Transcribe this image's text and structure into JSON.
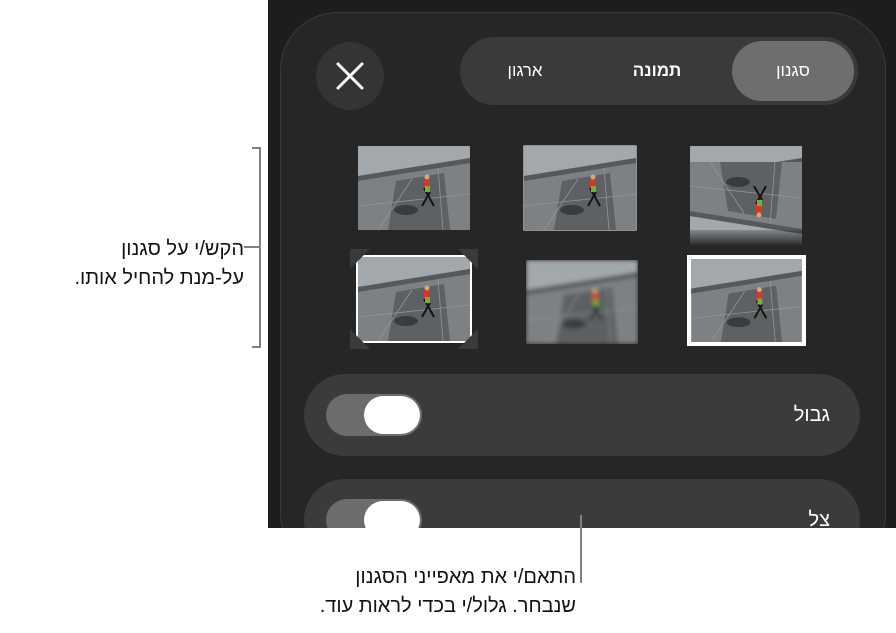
{
  "tabs": [
    {
      "label": "סגנון",
      "selected": true
    },
    {
      "label": "תמונה",
      "selected": false
    },
    {
      "label": "ארגון",
      "selected": false
    }
  ],
  "close_button": {
    "icon": "close-icon"
  },
  "styles": [
    {
      "name": "plain",
      "selected": false
    },
    {
      "name": "thin-white-border",
      "selected": false
    },
    {
      "name": "reflection",
      "selected": false
    },
    {
      "name": "photo-corners",
      "selected": false
    },
    {
      "name": "soft-edges",
      "selected": false
    },
    {
      "name": "thick-white-border",
      "selected": false
    }
  ],
  "rows": [
    {
      "label": "גבול",
      "toggle_on": false
    },
    {
      "label": "צל",
      "toggle_on": false
    }
  ],
  "callouts": {
    "styles_line1": "הקש/י על סגנון",
    "styles_line2": "על-מנת להחיל אותו.",
    "options_line1": "התאם/י את מאפייני הסגנון",
    "options_line2": "שנבחר. גלול/י בכדי לראות עוד."
  },
  "colors": {
    "panel": "#262626",
    "selected_tab": "#6e6e6e",
    "row": "#3b3b3b"
  }
}
